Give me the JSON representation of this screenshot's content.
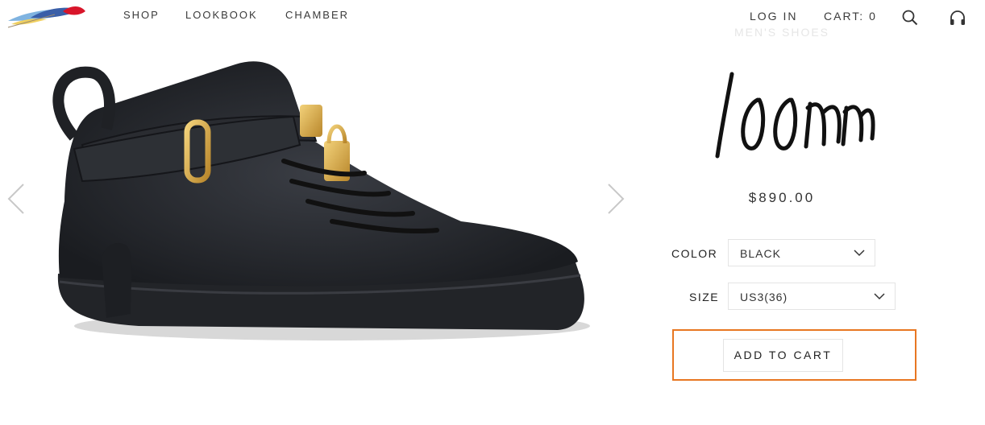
{
  "header": {
    "nav": [
      {
        "label": "SHOP"
      },
      {
        "label": "LOOKBOOK"
      },
      {
        "label": "CHAMBER"
      }
    ],
    "login_label": "LOG IN",
    "cart_label": "CART: 0"
  },
  "icons": {
    "logo": "feather-logo-icon",
    "search": "search-icon",
    "support": "headphones-icon",
    "prev": "chevron-left-icon",
    "next": "chevron-right-icon"
  },
  "product": {
    "category": "MEN'S SHOES",
    "name": "100mm",
    "price": "$890.00",
    "color": {
      "label": "COLOR",
      "value": "BLACK"
    },
    "size": {
      "label": "SIZE",
      "value": "US3(36)"
    },
    "add_to_cart_label": "ADD TO CART"
  },
  "colors": {
    "highlight": "#e87722",
    "text": "#222222"
  }
}
